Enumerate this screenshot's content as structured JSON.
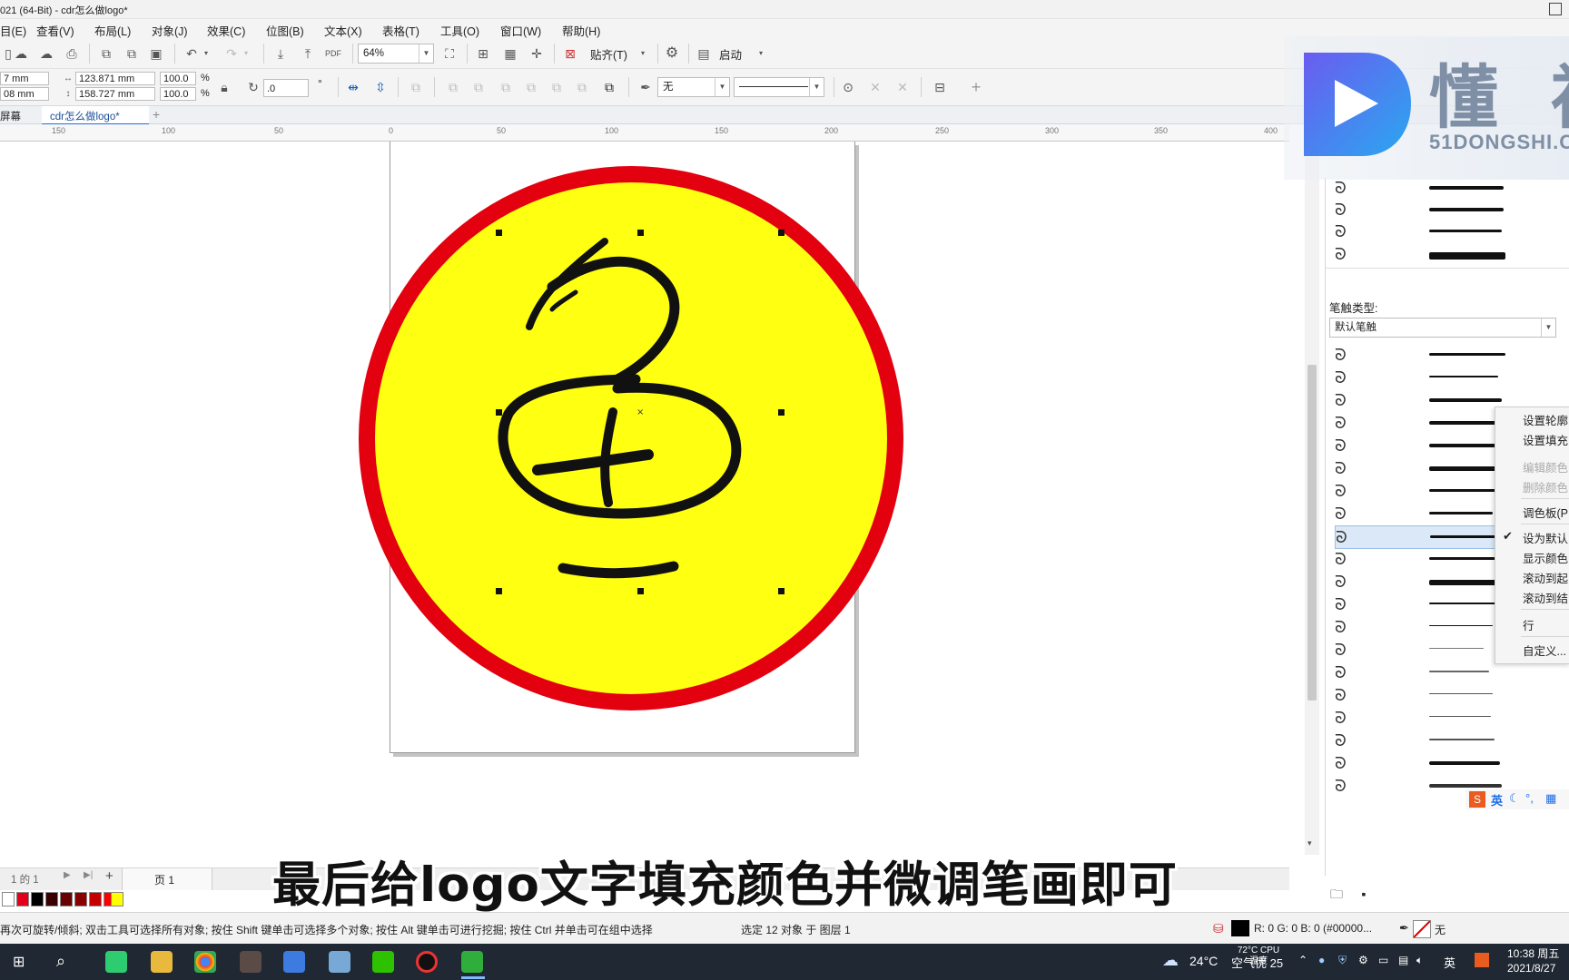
{
  "window": {
    "title": "021 (64-Bit) - cdr怎么做logo*"
  },
  "menu": [
    "目(E)",
    "查看(V)",
    "布局(L)",
    "对象(J)",
    "效果(C)",
    "位图(B)",
    "文本(X)",
    "表格(T)",
    "工具(O)",
    "窗口(W)",
    "帮助(H)"
  ],
  "toolbar1": {
    "zoom": "64%",
    "snap_label": "贴齐(T)",
    "launch_label": "启动"
  },
  "toolbar2": {
    "x_pos": "7 mm",
    "y_pos": "08 mm",
    "width": "123.871 mm",
    "height": "158.727 mm",
    "scale_x": "100.0",
    "scale_y": "100.0",
    "pct": "%",
    "rotation": ".0",
    "degree": "°",
    "outline_width": "无"
  },
  "doc_tabs": {
    "tab1": "屏幕",
    "tab2": "cdr怎么做logo*",
    "add": "+"
  },
  "ruler": {
    "ticks": [
      "150",
      "100",
      "50",
      "0",
      "50",
      "100",
      "150",
      "200",
      "250",
      "300",
      "350",
      "400"
    ]
  },
  "docker": {
    "brush_type_label": "笔触类型:",
    "brush_type_value": "默认笔触"
  },
  "context_menu": {
    "items": [
      {
        "label": "设置轮廓",
        "disabled": false
      },
      {
        "label": "设置填充",
        "disabled": false
      },
      {
        "label": "编辑颜色",
        "disabled": true
      },
      {
        "label": "删除颜色",
        "disabled": true
      },
      {
        "label": "调色板(P",
        "disabled": false
      },
      {
        "label": "设为默认",
        "disabled": false,
        "checked": true
      },
      {
        "label": "显示颜色",
        "disabled": false
      },
      {
        "label": "滚动到起",
        "disabled": false
      },
      {
        "label": "滚动到结",
        "disabled": false
      },
      {
        "label": "行",
        "disabled": false
      },
      {
        "label": "自定义...",
        "disabled": false
      }
    ]
  },
  "watermark": {
    "brand": "懂 视",
    "site": "51DONGSHI.C"
  },
  "ime_bar": {
    "label": "英"
  },
  "page_nav": {
    "counter": "1 的 1",
    "page_tab": "页 1"
  },
  "palette": {
    "colors": [
      "#ffffff",
      "#e3001b",
      "#000000",
      "#3a0000",
      "#6a0000",
      "#8a0000",
      "#c40000",
      "#ff0000",
      "#ffff00"
    ]
  },
  "status": {
    "hint": "再次可旋转/倾斜; 双击工具可选择所有对象; 按住 Shift 键单击可选择多个对象; 按住 Alt 键单击可进行挖掘; 按住 Ctrl 并单击可在组中选择",
    "selection": "选定 12 对象 于 图层 1",
    "color_readout": "R: 0 G: 0 B: 0 (#00000...",
    "outline_none": "无"
  },
  "taskbar": {
    "weather": "24°C",
    "weather_text": "空气优 25",
    "cpu": "72°C CPU温度",
    "ime": "英",
    "time": "10:38 周五",
    "date": "2021/8/27"
  },
  "subtitle": "最后给logo文字填充颜色并微调笔画即可",
  "colors": {
    "yellow": "#ffff12",
    "red": "#e3000f",
    "accent_blue": "#1e6ee6"
  }
}
